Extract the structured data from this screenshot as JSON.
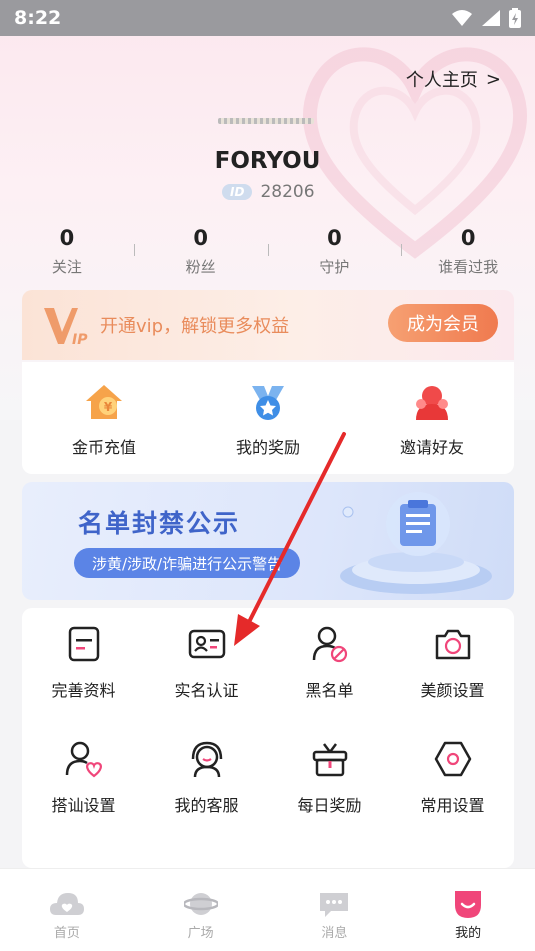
{
  "status_bar": {
    "time": "8:22"
  },
  "header": {
    "profile_link": "个人主页",
    "profile_chevron": ">"
  },
  "user": {
    "name": "FORYOU",
    "id_badge": "ID",
    "id": "28206"
  },
  "stats": [
    {
      "value": "0",
      "label": "关注"
    },
    {
      "value": "0",
      "label": "粉丝"
    },
    {
      "value": "0",
      "label": "守护"
    },
    {
      "value": "0",
      "label": "谁看过我"
    }
  ],
  "vip": {
    "text": "开通vip，解锁更多权益",
    "button": "成为会员"
  },
  "quick_actions": [
    {
      "label": "金币充值",
      "icon": "coin-house-icon"
    },
    {
      "label": "我的奖励",
      "icon": "reward-medal-icon"
    },
    {
      "label": "邀请好友",
      "icon": "invite-friend-icon"
    }
  ],
  "ban_banner": {
    "title": "名单封禁公示",
    "subtitle": "涉黄/涉政/诈骗进行公示警告"
  },
  "settings": [
    {
      "label": "完善资料",
      "icon": "document-icon"
    },
    {
      "label": "实名认证",
      "icon": "id-card-icon"
    },
    {
      "label": "黑名单",
      "icon": "blocked-user-icon"
    },
    {
      "label": "美颜设置",
      "icon": "camera-icon"
    },
    {
      "label": "搭讪设置",
      "icon": "user-heart-icon"
    },
    {
      "label": "我的客服",
      "icon": "headset-icon"
    },
    {
      "label": "每日奖励",
      "icon": "gift-icon"
    },
    {
      "label": "常用设置",
      "icon": "hexagon-settings-icon"
    }
  ],
  "bottom_nav": [
    {
      "label": "首页",
      "icon": "home-cloud-icon",
      "active": false
    },
    {
      "label": "广场",
      "icon": "planet-icon",
      "active": false
    },
    {
      "label": "消息",
      "icon": "chat-bubble-icon",
      "active": false
    },
    {
      "label": "我的",
      "icon": "me-face-icon",
      "active": true
    }
  ],
  "colors": {
    "accent": "#f07a4f",
    "brand_pink": "#f0467a",
    "vip_text": "#e98c5c",
    "ban_blue": "#3f64c9",
    "annotation_arrow": "#e52a2a"
  }
}
